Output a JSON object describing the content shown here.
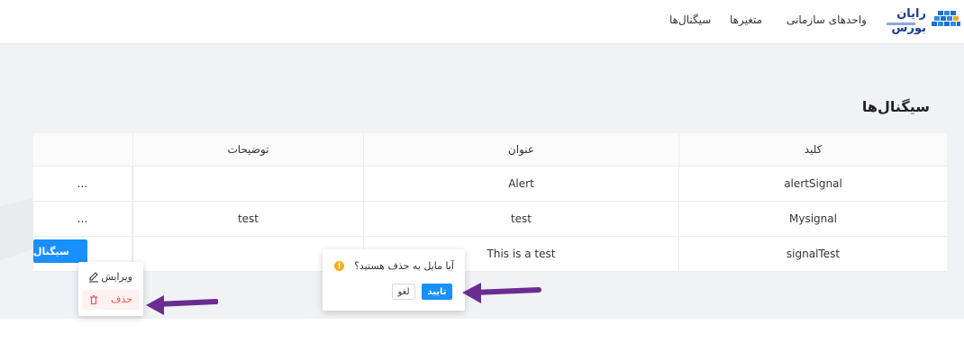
{
  "header": {
    "logo_text": "رایان بورس",
    "nav": [
      "واحدهای سازمانی",
      "متغیرها",
      "سیگنال‌ها"
    ]
  },
  "page": {
    "title": "سیگنال‌ها"
  },
  "table": {
    "columns": [
      "کلید",
      "عنوان",
      "توضیحات"
    ],
    "rows": [
      {
        "key": "alertSignal",
        "title": "Alert",
        "description": "",
        "actions": "..."
      },
      {
        "key": "Mysignal",
        "title": "test",
        "description": "test",
        "actions": "..."
      },
      {
        "key": "signalTest",
        "title": "This is a test",
        "description": "",
        "actions": "..."
      }
    ]
  },
  "add_button": {
    "label": "سیگنال"
  },
  "row_menu": {
    "edit_label": "ویرایش",
    "delete_label": "حذف"
  },
  "popconfirm": {
    "message": "آیا مایل به حذف هستید؟",
    "ok_label": "تایید",
    "cancel_label": "لغو"
  },
  "colors": {
    "primary": "#1890ff",
    "danger": "#ff4d4f",
    "warning": "#faad14",
    "annotation_arrow": "#6a2c91"
  }
}
